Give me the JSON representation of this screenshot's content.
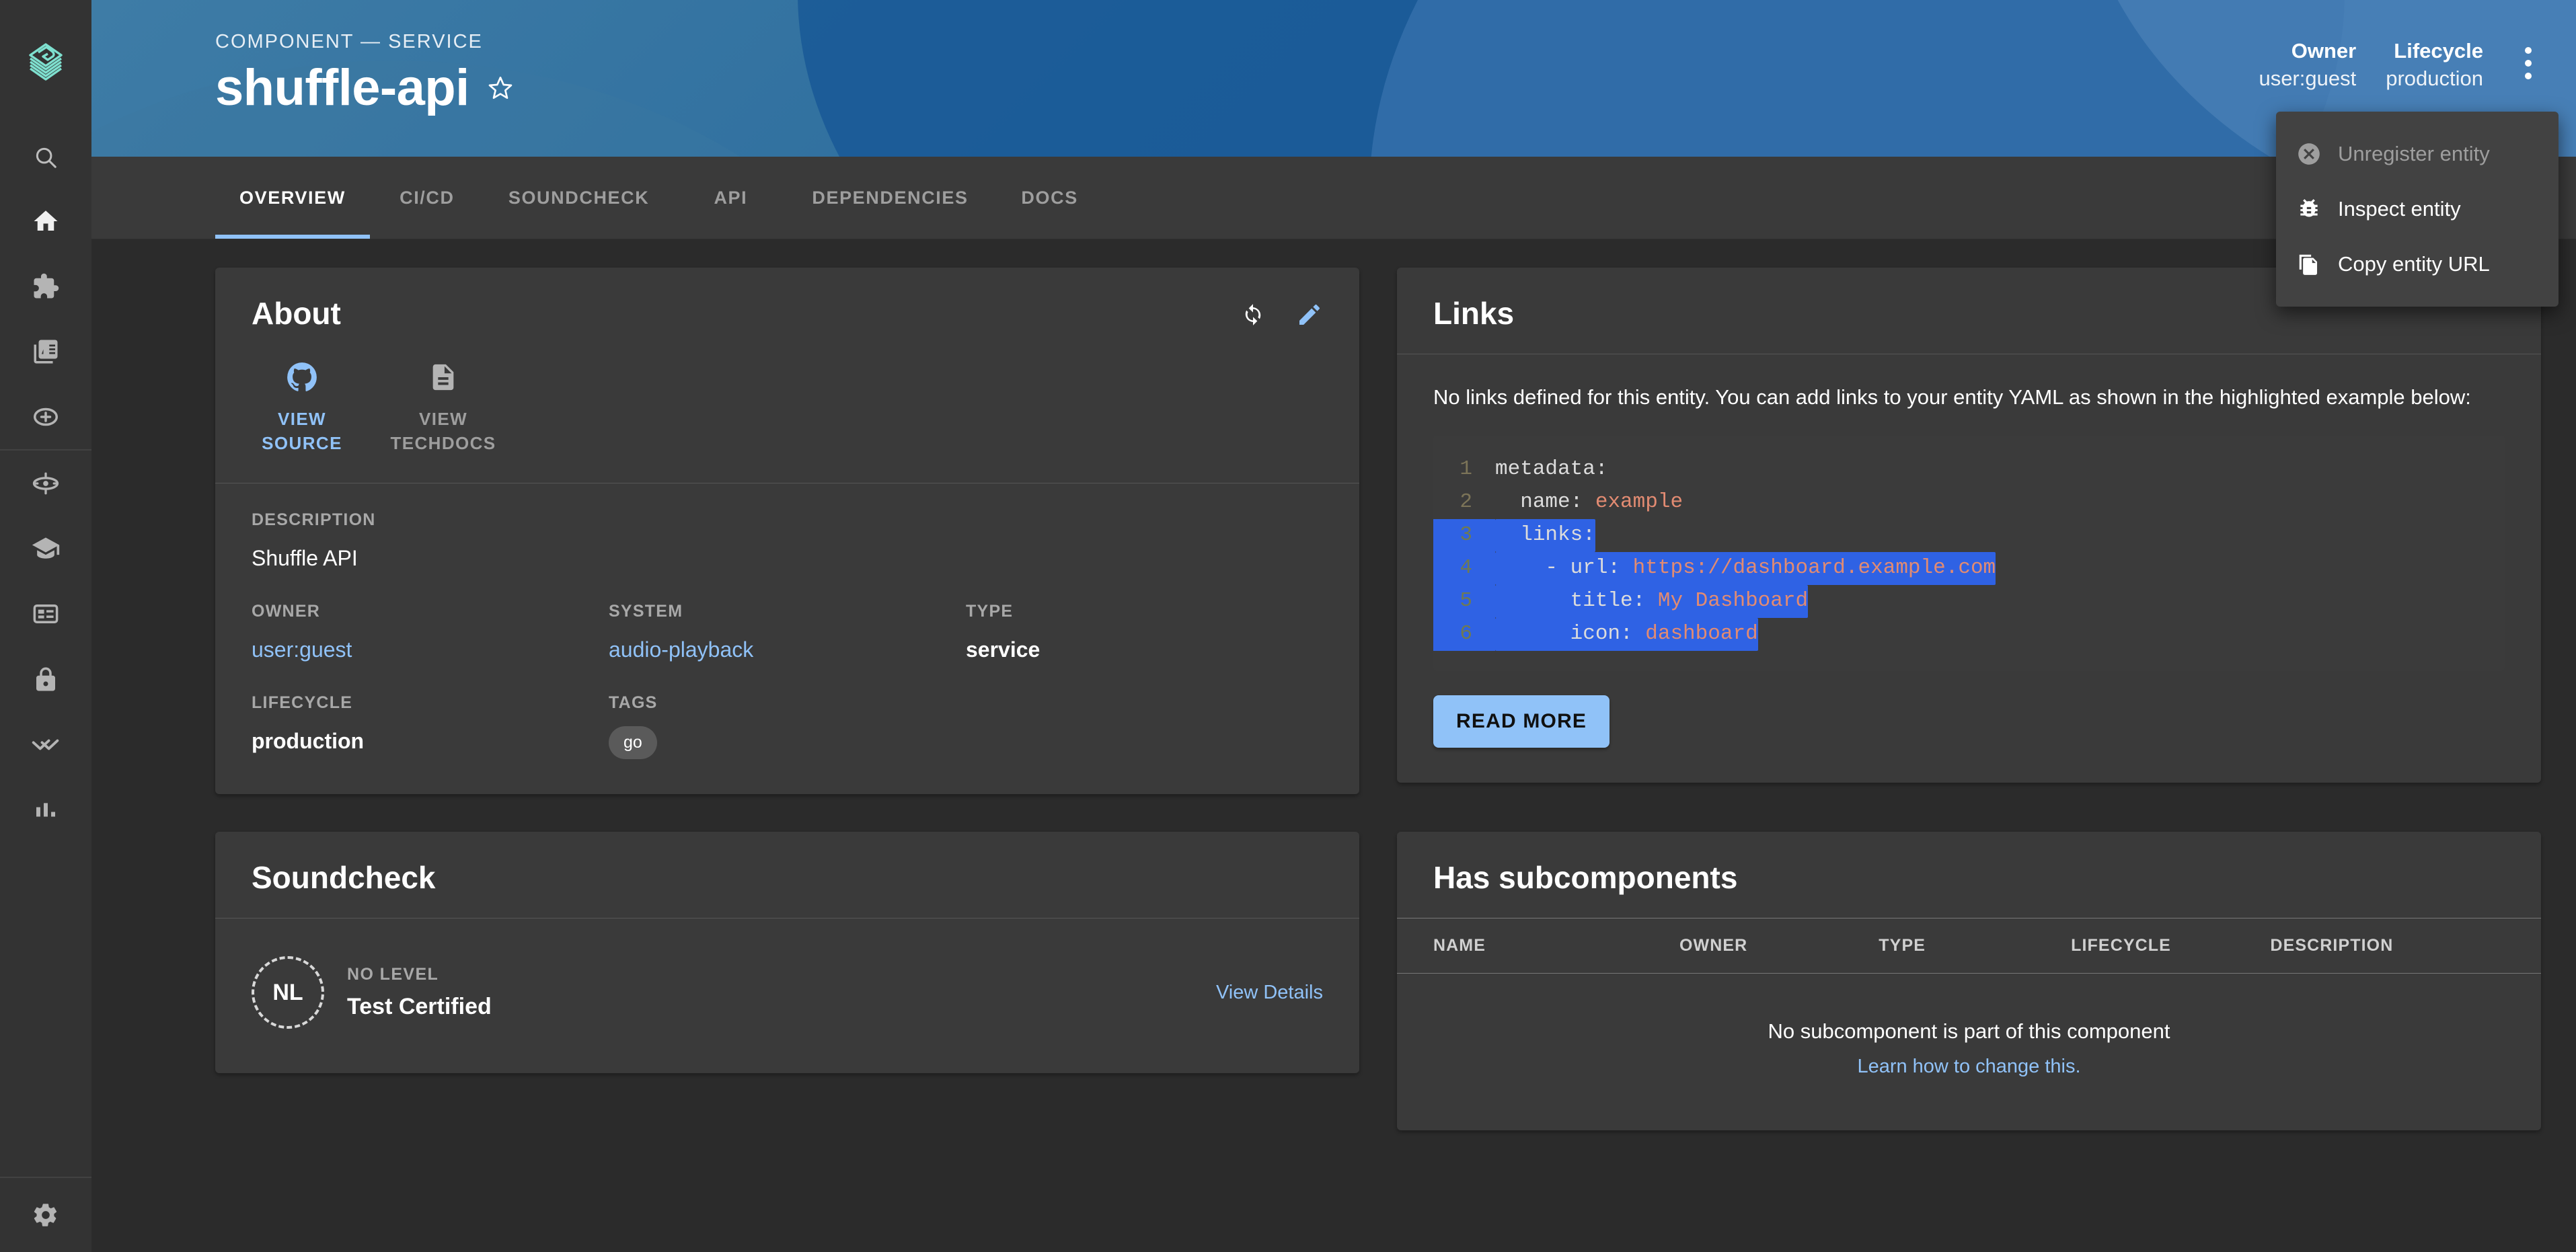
{
  "sidebar": {
    "logo_name": "backstage-logo",
    "logo_color": "#7ee0cf",
    "search": {
      "icon": "search-icon"
    },
    "items": [
      {
        "icon": "home-icon",
        "name": "home"
      },
      {
        "icon": "extension-icon",
        "name": "apis"
      },
      {
        "icon": "library-books-icon",
        "name": "docs"
      },
      {
        "icon": "add-circle-outline-icon",
        "name": "create"
      },
      {
        "icon": "track-changes-icon",
        "name": "tech-radar"
      },
      {
        "icon": "school-icon",
        "name": "learning-paths"
      },
      {
        "icon": "card-membership-icon",
        "name": "soundcheck"
      },
      {
        "icon": "lock-icon",
        "name": "security"
      },
      {
        "icon": "double-arrow-icon",
        "name": "skill-exchange"
      },
      {
        "icon": "bar-chart-icon",
        "name": "insights"
      }
    ],
    "settings": {
      "icon": "settings-gear-icon",
      "name": "settings"
    }
  },
  "header": {
    "kicker": "COMPONENT — SERVICE",
    "title": "shuffle-api",
    "favorite_icon": "star-outline-icon",
    "fields": [
      {
        "label": "Owner",
        "value": "user:guest"
      },
      {
        "label": "Lifecycle",
        "value": "production"
      }
    ],
    "more_menu_icon": "more-vert-icon",
    "gradient_start": "#3e7ca6",
    "gradient_end": "#2a69a3"
  },
  "menu": {
    "items": [
      {
        "label": "Unregister entity",
        "icon": "cancel-icon",
        "disabled": true
      },
      {
        "label": "Inspect entity",
        "icon": "bug-report-icon",
        "disabled": false
      },
      {
        "label": "Copy entity URL",
        "icon": "file-copy-icon",
        "disabled": false
      }
    ]
  },
  "tabs": [
    {
      "label": "OVERVIEW",
      "active": true
    },
    {
      "label": "CI/CD",
      "active": false
    },
    {
      "label": "SOUNDCHECK",
      "active": false
    },
    {
      "label": "API",
      "active": false
    },
    {
      "label": "DEPENDENCIES",
      "active": false
    },
    {
      "label": "DOCS",
      "active": false
    }
  ],
  "about": {
    "title": "About",
    "refresh_icon": "refresh-icon",
    "edit_icon": "edit-pencil-icon",
    "quick_links": [
      {
        "line1": "VIEW",
        "line2": "SOURCE",
        "icon": "github-icon",
        "enabled": true
      },
      {
        "line1": "VIEW",
        "line2": "TECHDOCS",
        "icon": "description-doc-icon",
        "enabled": false
      }
    ],
    "description_label": "DESCRIPTION",
    "description_value": "Shuffle API",
    "fields": [
      {
        "label": "OWNER",
        "value": "user:guest",
        "kind": "link"
      },
      {
        "label": "SYSTEM",
        "value": "audio-playback",
        "kind": "link"
      },
      {
        "label": "TYPE",
        "value": "service",
        "kind": "text"
      },
      {
        "label": "LIFECYCLE",
        "value": "production",
        "kind": "text"
      },
      {
        "label": "TAGS",
        "value": "go",
        "kind": "chip"
      }
    ]
  },
  "links": {
    "title": "Links",
    "note": "No links defined for this entity. You can add links to your entity YAML as shown in the highlighted example below:",
    "code": [
      {
        "n": "1",
        "indent": 0,
        "key": "metadata:",
        "value": "",
        "highlight": false
      },
      {
        "n": "2",
        "indent": 1,
        "key": "name:",
        "value": "example",
        "highlight": false
      },
      {
        "n": "3",
        "indent": 1,
        "key": "links:",
        "value": "",
        "highlight": true
      },
      {
        "n": "4",
        "indent": 2,
        "key": "- url:",
        "value": "https://dashboard.example.com",
        "highlight": true
      },
      {
        "n": "5",
        "indent": 3,
        "key": "title:",
        "value": "My Dashboard",
        "highlight": true
      },
      {
        "n": "6",
        "indent": 3,
        "key": "icon:",
        "value": "dashboard",
        "highlight": true
      }
    ],
    "read_more_label": "READ MORE",
    "highlight_color": "#2f62e4",
    "string_color": "#e28b72"
  },
  "soundcheck": {
    "title": "Soundcheck",
    "badge_initials": "NL",
    "level_label": "NO LEVEL",
    "certification_name": "Test Certified",
    "view_details_label": "View Details"
  },
  "subcomponents": {
    "title": "Has subcomponents",
    "columns": [
      "NAME",
      "OWNER",
      "TYPE",
      "LIFECYCLE",
      "DESCRIPTION"
    ],
    "empty_text": "No subcomponent is part of this component",
    "empty_link": "Learn how to change this."
  }
}
